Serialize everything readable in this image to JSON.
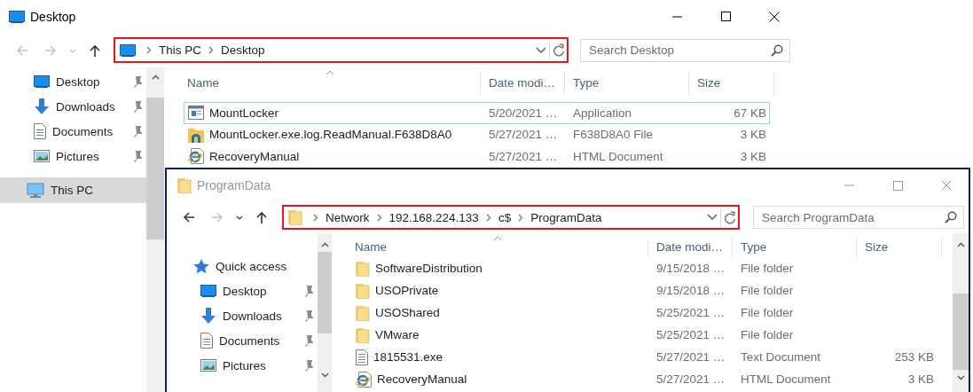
{
  "windows": [
    {
      "title": "Desktop",
      "active": true,
      "kind": "monitor",
      "nav_buttons": [
        {
          "kind": "back",
          "disabled": true
        },
        {
          "kind": "forward",
          "disabled": true
        },
        {
          "kind": "recent",
          "disabled": true
        },
        {
          "kind": "up",
          "disabled": false
        }
      ],
      "address": {
        "kind": "monitor",
        "crumbs": [
          "This PC",
          "Desktop"
        ]
      },
      "search": {
        "placeholder": "Search Desktop"
      },
      "sidebar": [
        {
          "label": "Desktop",
          "kind": "monitor",
          "pinned": true,
          "selected": false
        },
        {
          "label": "Downloads",
          "kind": "download",
          "pinned": true,
          "selected": false
        },
        {
          "label": "Documents",
          "kind": "document",
          "pinned": true,
          "selected": false
        },
        {
          "label": "Pictures",
          "kind": "pictures",
          "pinned": true,
          "selected": false
        },
        {
          "label": "This PC",
          "kind": "pc",
          "pinned": false,
          "selected": true
        }
      ],
      "columns": [
        "Name",
        "Date modi…",
        "Type",
        "Size"
      ],
      "rows": [
        {
          "kind": "app",
          "name": "MountLocker",
          "date": "5/20/2021 …",
          "type": "Application",
          "size": "67 KB",
          "selected": true
        },
        {
          "kind": "log",
          "name": "MountLocker.exe.log.ReadManual.F638D8A0",
          "date": "5/27/2021 …",
          "type": "F638D8A0 File",
          "size": "3 KB",
          "selected": false
        },
        {
          "kind": "html",
          "name": "RecoveryManual",
          "date": "5/27/2021 …",
          "type": "HTML Document",
          "size": "3 KB",
          "selected": false
        }
      ]
    },
    {
      "title": "ProgramData",
      "active": false,
      "kind": "folder",
      "nav_buttons": [
        {
          "kind": "back",
          "disabled": false
        },
        {
          "kind": "forward",
          "disabled": true
        },
        {
          "kind": "recent",
          "disabled": false
        },
        {
          "kind": "up",
          "disabled": false
        }
      ],
      "address": {
        "kind": "folder",
        "crumbs": [
          "Network",
          "192.168.224.133",
          "c$",
          "ProgramData"
        ]
      },
      "search": {
        "placeholder": "Search ProgramData"
      },
      "sidebar": [
        {
          "label": "Quick access",
          "kind": "star",
          "pinned": false,
          "selected": false,
          "children": [
            {
              "label": "Desktop",
              "kind": "monitor",
              "pinned": true,
              "selected": false
            },
            {
              "label": "Downloads",
              "kind": "download",
              "pinned": true,
              "selected": false
            },
            {
              "label": "Documents",
              "kind": "document",
              "pinned": true,
              "selected": false
            },
            {
              "label": "Pictures",
              "kind": "pictures",
              "pinned": true,
              "selected": false
            }
          ]
        }
      ],
      "columns": [
        "Name",
        "Date modi…",
        "Type",
        "Size"
      ],
      "rows": [
        {
          "kind": "folder",
          "name": "SoftwareDistribution",
          "date": "9/15/2018 …",
          "type": "File folder",
          "selected": false
        },
        {
          "kind": "folder",
          "name": "USOPrivate",
          "date": "9/15/2018 …",
          "type": "File folder",
          "selected": false
        },
        {
          "kind": "folder",
          "name": "USOShared",
          "date": "5/25/2021 …",
          "type": "File folder",
          "selected": false
        },
        {
          "kind": "folder",
          "name": "VMware",
          "date": "5/25/2021 …",
          "type": "File folder",
          "selected": false
        },
        {
          "kind": "text",
          "name": "1815531.exe",
          "date": "5/27/2021 …",
          "type": "Text Document",
          "size": "253 KB",
          "selected": false
        },
        {
          "kind": "html",
          "name": "RecoveryManual",
          "date": "5/27/2021 …",
          "type": "HTML Document",
          "size": "3 KB",
          "selected": false
        }
      ]
    }
  ]
}
